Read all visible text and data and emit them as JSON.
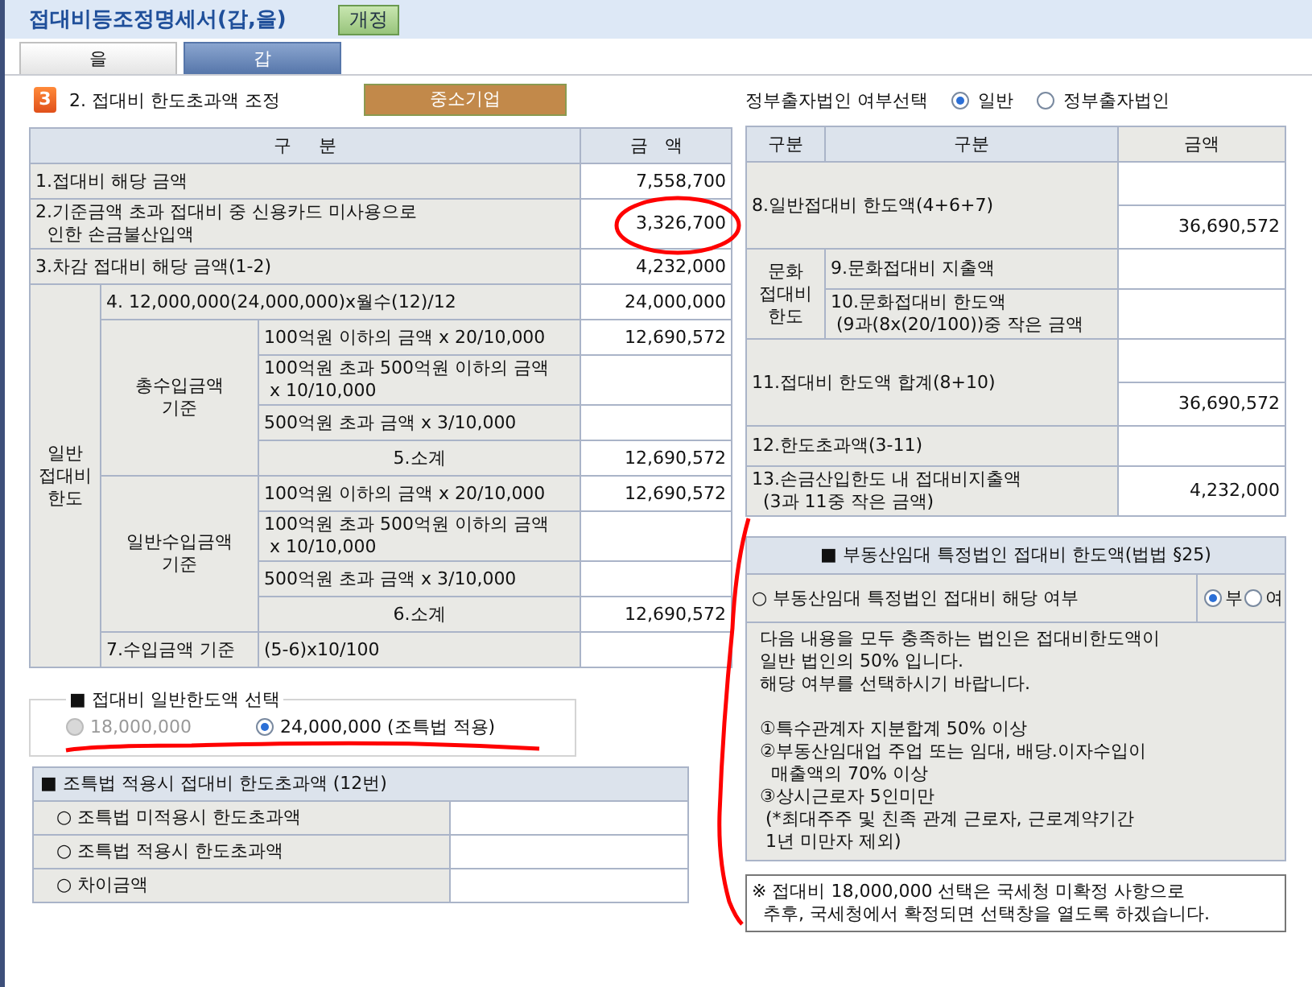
{
  "header": {
    "title": "접대비등조정명세서(갑,을)",
    "button": "개정"
  },
  "tabs": [
    {
      "label": "을",
      "selected": false
    },
    {
      "label": "갑",
      "selected": true
    }
  ],
  "section": {
    "number": "3",
    "title": "2. 접대비 한도초과액 조정",
    "company_type": "중소기업"
  },
  "left_table": {
    "columns": [
      "구     분",
      "금   액"
    ],
    "top_rows": [
      {
        "label": "1.접대비 해당 금액",
        "amount": "7,558,700"
      },
      {
        "label": "2.기준금액 초과 접대비 중 신용카드 미사용으로\n  인한 손금불산입액",
        "amount": "3,326,700"
      },
      {
        "label": "3.차감 접대비 해당 금액(1-2)",
        "amount": "4,232,000"
      }
    ],
    "general_limit": {
      "label": "일반\n접대비\n한도",
      "row4": {
        "label": "4. 12,000,000(24,000,000)x월수(12)/12",
        "amount": "24,000,000"
      },
      "groups": [
        {
          "label": "총수입금액\n기준",
          "rows": [
            {
              "label": "100억원 이하의 금액 x 20/10,000",
              "amount": "12,690,572"
            },
            {
              "label": "100억원 초과 500억원 이하의 금액\n x 10/10,000"
            },
            {
              "label": "500억원 초과 금액 x 3/10,000"
            }
          ],
          "subtotal": {
            "label": "5.소계",
            "amount": "12,690,572"
          }
        },
        {
          "label": "일반수입금액\n기준",
          "rows": [
            {
              "label": "100억원 이하의 금액 x 20/10,000",
              "amount": "12,690,572"
            },
            {
              "label": "100억원 초과 500억원 이하의 금액\n x 10/10,000"
            },
            {
              "label": "500억원 초과 금액 x 3/10,000"
            }
          ],
          "subtotal": {
            "label": "6.소계",
            "amount": "12,690,572"
          }
        }
      ],
      "row7": {
        "label": "7.수입금액 기준",
        "formula": "(5-6)x10/100"
      }
    }
  },
  "limit_selection": {
    "title": "■ 접대비 일반한도액 선택",
    "options": [
      {
        "label": "18,000,000",
        "selected": false,
        "disabled": true
      },
      {
        "label": "24,000,000 (조특법 적용)",
        "selected": true,
        "disabled": false
      }
    ]
  },
  "special_excess": {
    "title": "■ 조특법 적용시 접대비 한도초과액 (12번)",
    "rows": [
      {
        "label": "○ 조특법 미적용시 한도초과액"
      },
      {
        "label": "○ 조특법 적용시 한도초과액"
      },
      {
        "label": "○ 차이금액"
      }
    ]
  },
  "gov_selection": {
    "label": "정부출자법인 여부선택",
    "options": [
      {
        "label": "일반",
        "selected": true
      },
      {
        "label": "정부출자법인",
        "selected": false
      }
    ]
  },
  "right_table": {
    "columns": [
      "구분",
      "구분",
      "금액"
    ],
    "rows": [
      {
        "kind": "split",
        "label": "8.일반접대비 한도액(4+6+7)",
        "amount": "36,690,572"
      },
      {
        "kind": "group",
        "label": "문화\n접대비\n한도",
        "items": [
          {
            "label": "9.문화접대비 지출액"
          },
          {
            "label": "10.문화접대비 한도액\n (9과(8x(20/100))중 작은 금액"
          }
        ]
      },
      {
        "kind": "split",
        "label": "11.접대비 한도액 합계(8+10)",
        "amount": "36,690,572"
      },
      {
        "kind": "single",
        "label": "12.한도초과액(3-11)"
      },
      {
        "kind": "single",
        "label": "13.손금산입한도 내 접대비지출액\n  (3과 11중 작은 금액)",
        "amount": "4,232,000"
      }
    ]
  },
  "real_estate": {
    "title": "■ 부동산임대 특정법인 접대비 한도액(법법 §25)",
    "question": "○ 부동산임대 특정법인 접대비 해당 여부",
    "options": [
      {
        "label": "부",
        "selected": true
      },
      {
        "label": "여",
        "selected": false
      }
    ],
    "notice": "다음 내용을 모두 충족하는 법인은 접대비한도액이\n일반 법인의 50% 입니다.\n해당 여부를 선택하시기 바랍니다.\n\n①특수관계자 지분합계 50% 이상\n②부동산임대업 주업 또는 임대, 배당.이자수입이\n  매출액의 70% 이상\n③상시근로자 5인미만\n (*최대주주 및 친족 관계 근로자, 근로계약기간\n 1년 미만자 제외)"
  },
  "note": "※ 접대비 18,000,000 선택은 국세청 미확정 사항으로\n  추후, 국세청에서 확정되면 선택창을 열도록 하겠습니다."
}
